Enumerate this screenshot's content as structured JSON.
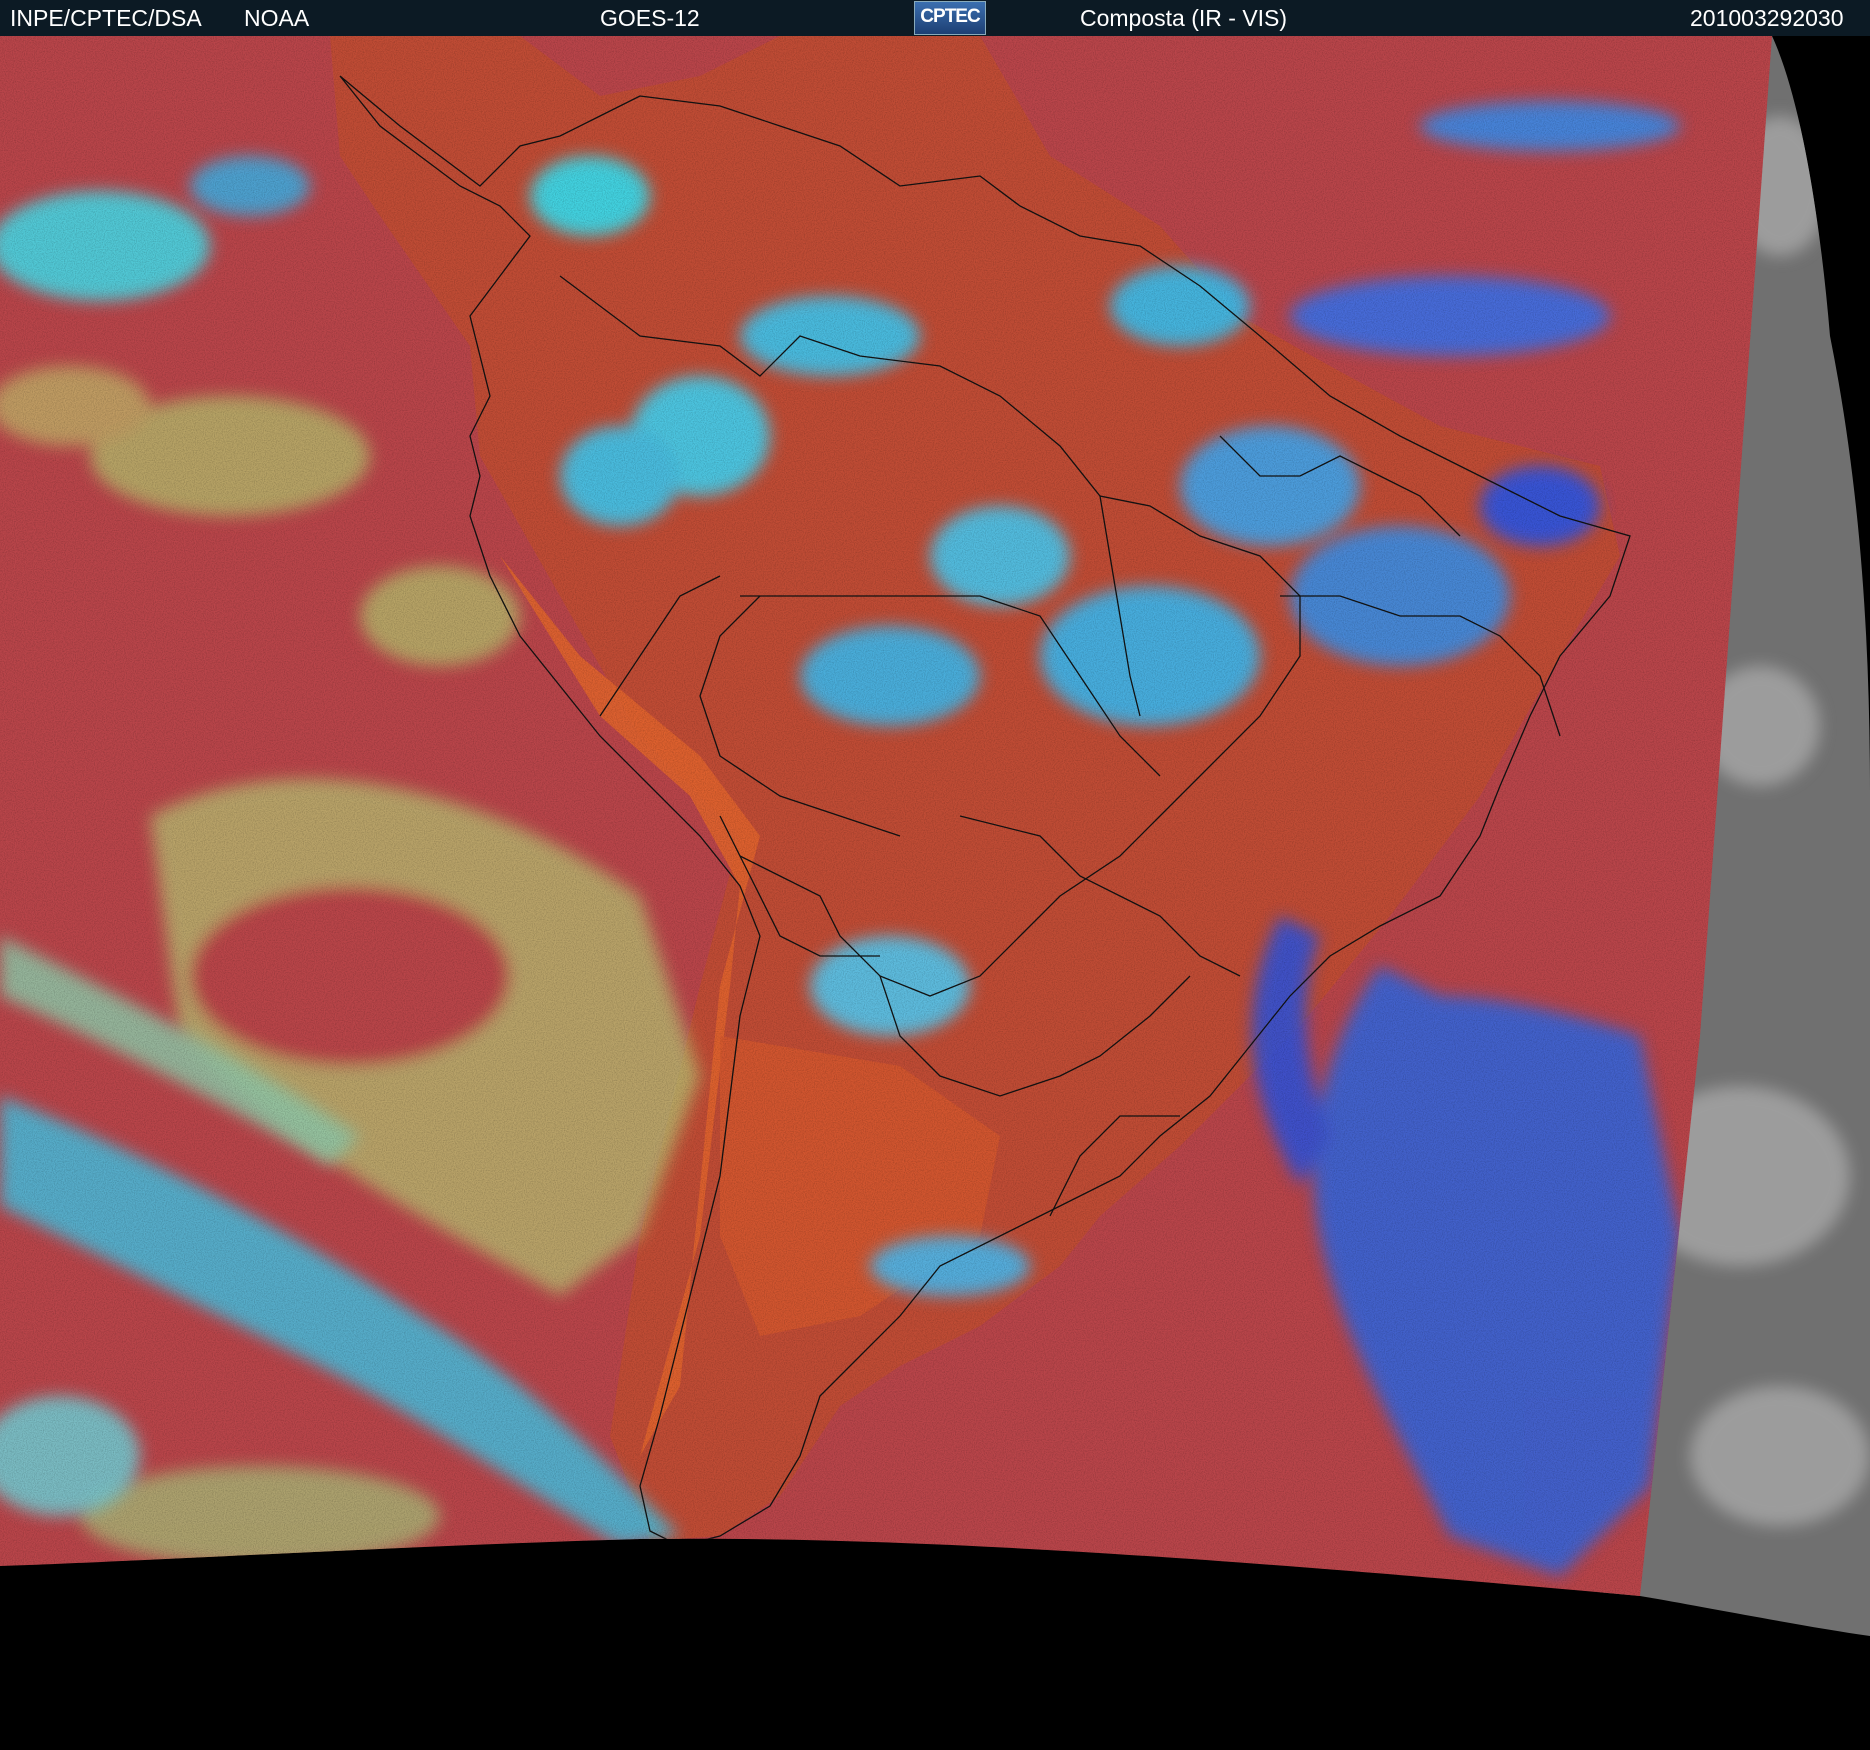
{
  "header": {
    "institution": "INPE/CPTEC/DSA",
    "agency": "NOAA",
    "satellite": "GOES-12",
    "logo_text": "CPTEC",
    "product": "Composta (IR - VIS)",
    "timestamp": "201003292030"
  },
  "colors": {
    "header_bg": "#0c1a24",
    "sea_clear": "#b9454a",
    "land_clear": "#c44a34",
    "high_cloud": "#39b9ee",
    "deep_cloud": "#2a5fe0",
    "low_cloud": "#b5c77a",
    "gray_vis": "#7c7c7c",
    "no_data": "#000000"
  }
}
